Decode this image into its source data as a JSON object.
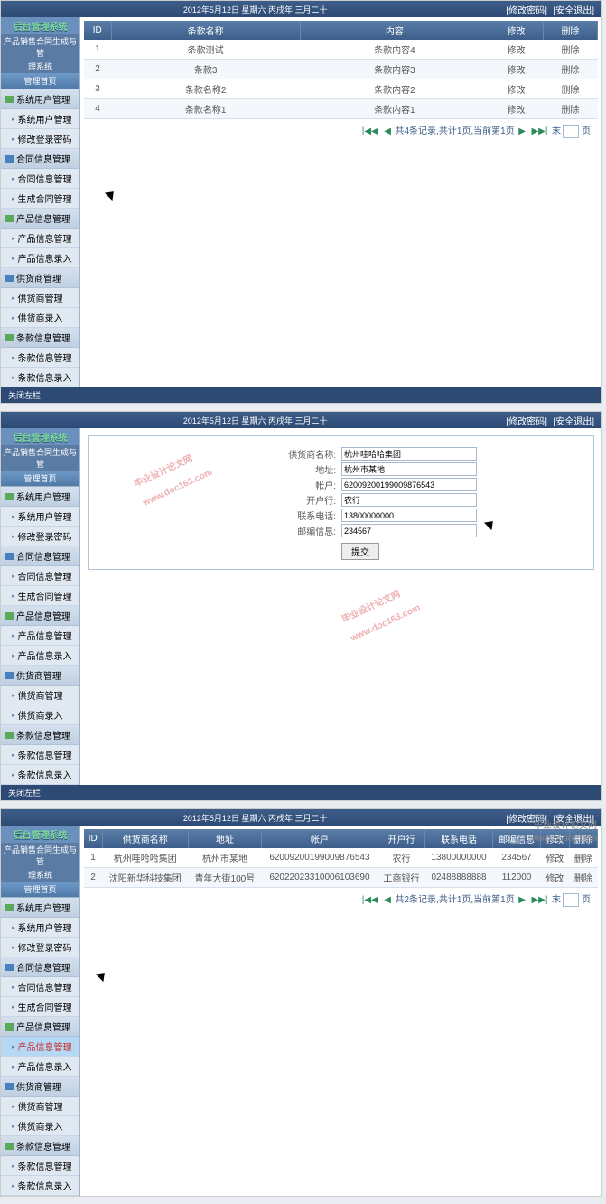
{
  "topbar": {
    "date": "2012年5月12日 星期六 丙戌年 三月二十",
    "links": {
      "pwd": "[修改密码]",
      "exit": "[安全退出]"
    }
  },
  "logo": "后台管理系统",
  "subtitle1": "产品销售合同生成与管",
  "subtitle2": "理系统",
  "home": "管理首页",
  "nav": {
    "group1": "系统用户管理",
    "items1": [
      "系统用户管理",
      "修改登录密码"
    ],
    "group2": "合同信息管理",
    "items2": [
      "合同信息管理",
      "生成合同管理"
    ],
    "group3": "产品信息管理",
    "items3": [
      "产品信息管理",
      "产品信息录入"
    ],
    "group4": "供货商管理",
    "items4": [
      "供货商管理",
      "供货商录入"
    ],
    "group5": "条款信息管理",
    "items5": [
      "条款信息管理",
      "条款信息录入"
    ]
  },
  "closebar": "关闭左栏",
  "screen1": {
    "headers": [
      "ID",
      "条款名称",
      "内容",
      "修改",
      "删除"
    ],
    "rows": [
      [
        "1",
        "条款测试",
        "条款内容4",
        "修改",
        "删除"
      ],
      [
        "2",
        "条款3",
        "条款内容3",
        "修改",
        "删除"
      ],
      [
        "3",
        "条款名称2",
        "条款内容2",
        "修改",
        "删除"
      ],
      [
        "4",
        "条款名称1",
        "条款内容1",
        "修改",
        "删除"
      ]
    ],
    "pager": "共4条记录,共计1页,当前第1页",
    "pager_nav": {
      "first": "|◀◀",
      "prev": "◀",
      "next": "▶",
      "last": "▶▶|",
      "tail": "末",
      "page_suffix": "页"
    }
  },
  "screen2": {
    "form": {
      "f1": {
        "label": "供货商名称:",
        "value": "杭州哇哈哈集团"
      },
      "f2": {
        "label": "地址:",
        "value": "杭州市某地"
      },
      "f3": {
        "label": "帐户:",
        "value": "62009200199009876543"
      },
      "f4": {
        "label": "开户行:",
        "value": "农行"
      },
      "f5": {
        "label": "联系电话:",
        "value": "13800000000"
      },
      "f6": {
        "label": "邮编信息:",
        "value": "234567"
      },
      "submit": "提交"
    }
  },
  "screen3": {
    "headers": [
      "ID",
      "供货商名称",
      "地址",
      "帐户",
      "开户行",
      "联系电话",
      "邮编信息",
      "修改",
      "删除"
    ],
    "rows": [
      [
        "1",
        "杭州哇哈哈集团",
        "杭州市某地",
        "62009200199009876543",
        "农行",
        "13800000000",
        "234567",
        "修改",
        "删除"
      ],
      [
        "2",
        "沈阳新华科技集团",
        "青年大街100号",
        "62022023310006103690",
        "工商银行",
        "02488888888",
        "112000",
        "修改",
        "删除"
      ]
    ],
    "pager": "共2条记录,共计1页,当前第1页"
  },
  "watermark": {
    "text": "毕业设计论文网",
    "url1": "www.doc163.com",
    "url2": "www.56doc.com"
  }
}
